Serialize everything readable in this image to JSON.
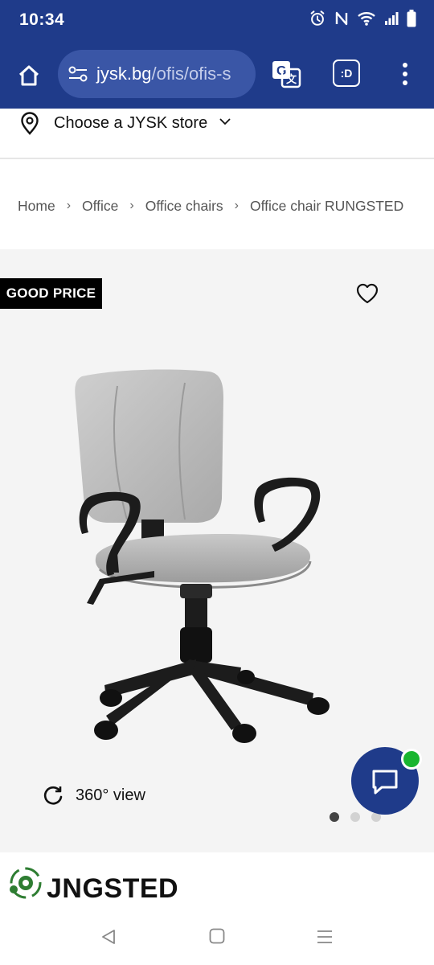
{
  "status_bar": {
    "time": "10:34",
    "icons": [
      "alarm-icon",
      "nfc-icon",
      "wifi-icon",
      "signal-icon",
      "battery-icon"
    ]
  },
  "browser": {
    "url_domain": "jysk.bg",
    "url_path": "/ofis/ofis-s",
    "tabs_label": ":D"
  },
  "store_selector": {
    "label": "Choose a JYSK store"
  },
  "breadcrumb": [
    "Home",
    "Office",
    "Office chairs",
    "Office chair RUNGSTED"
  ],
  "gallery": {
    "badge": "GOOD PRICE",
    "view360_label": "360° view",
    "total_images": 3,
    "active_image": 1
  },
  "product": {
    "title_visible": "JNGSTED"
  },
  "colors": {
    "brand_blue": "#1f3b8a",
    "online_green": "#19b52f"
  }
}
